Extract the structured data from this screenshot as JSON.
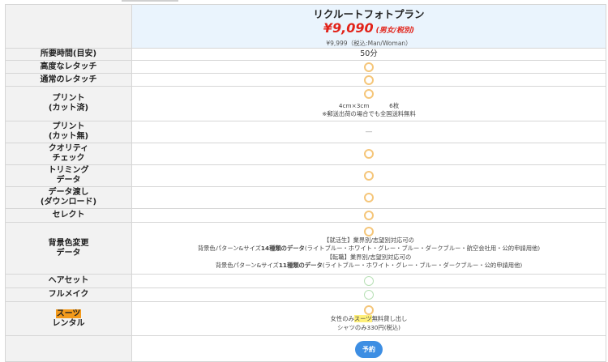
{
  "plan": {
    "name": "リクルートフォトプラン",
    "price": "¥9,090",
    "price_note": "(男女/税別)",
    "tax_price": "¥9,999（税込:Man/Woman）"
  },
  "rows": {
    "duration": {
      "label": "所要時間(目安)",
      "value": "50分"
    },
    "advanced_retouch": {
      "label": "高度なレタッチ"
    },
    "normal_retouch": {
      "label": "通常のレタッチ"
    },
    "print_cut": {
      "label_1": "プリント",
      "label_2": "(カット済)",
      "size": "4cm×3cm",
      "count": "6枚",
      "shipping": "※郵送出荷の場合でも全国送料無料"
    },
    "print_uncut": {
      "label_1": "プリント",
      "label_2": "(カット無)",
      "value": "—"
    },
    "quality_check": {
      "label_1": "クオリティ",
      "label_2": "チェック"
    },
    "trimming": {
      "label_1": "トリミング",
      "label_2": "データ"
    },
    "data_delivery": {
      "label_1": "データ渡し",
      "label_2": "(ダウンロード)"
    },
    "select": {
      "label": "セレクト"
    },
    "background": {
      "label_1": "背景色変更",
      "label_2": "データ",
      "job_hunting_head": "【就活生】業界別/志望別対応可の",
      "job_hunting_pre": "背景色パターン&サイズ",
      "job_hunting_bold": "14種類のデータ",
      "job_hunting_post": "(ライトブルー・ホワイト・グレー・ブルー・ダークブルー・航空会社用・公的申請用他)",
      "career_head": "【転職】業界別/志望別対応可の",
      "career_pre": "背景色パターン&サイズ",
      "career_bold": "11種類のデータ",
      "career_post": "(ライトブルー・ホワイト・グレー・ブルー・ダークブルー・公的申請用他)"
    },
    "hair_set": {
      "label": "ヘアセット"
    },
    "full_makeup": {
      "label": "フルメイク"
    },
    "suit_rental": {
      "label_1": "スーツ",
      "label_2": "レンタル",
      "line1_pre": "女性のみ",
      "line1_hl": "スーツ",
      "line1_post": "無料貸し出し",
      "line2": "シャツのみ330円(税込)"
    }
  },
  "reserve_button": {
    "label": "予約"
  },
  "colors": {
    "price_red": "#e2231a",
    "header_bg": "#eaf4fd",
    "label_bg": "#f2f2f2",
    "circle_orange": "#f5c67a",
    "circle_green": "#b8e0b6",
    "button_blue": "#3d8ee3",
    "highlight_yellow": "#fff07a",
    "highlight_orange": "#f39a1c"
  },
  "icons": {
    "included": "circle-icon",
    "not_included": "dash"
  }
}
